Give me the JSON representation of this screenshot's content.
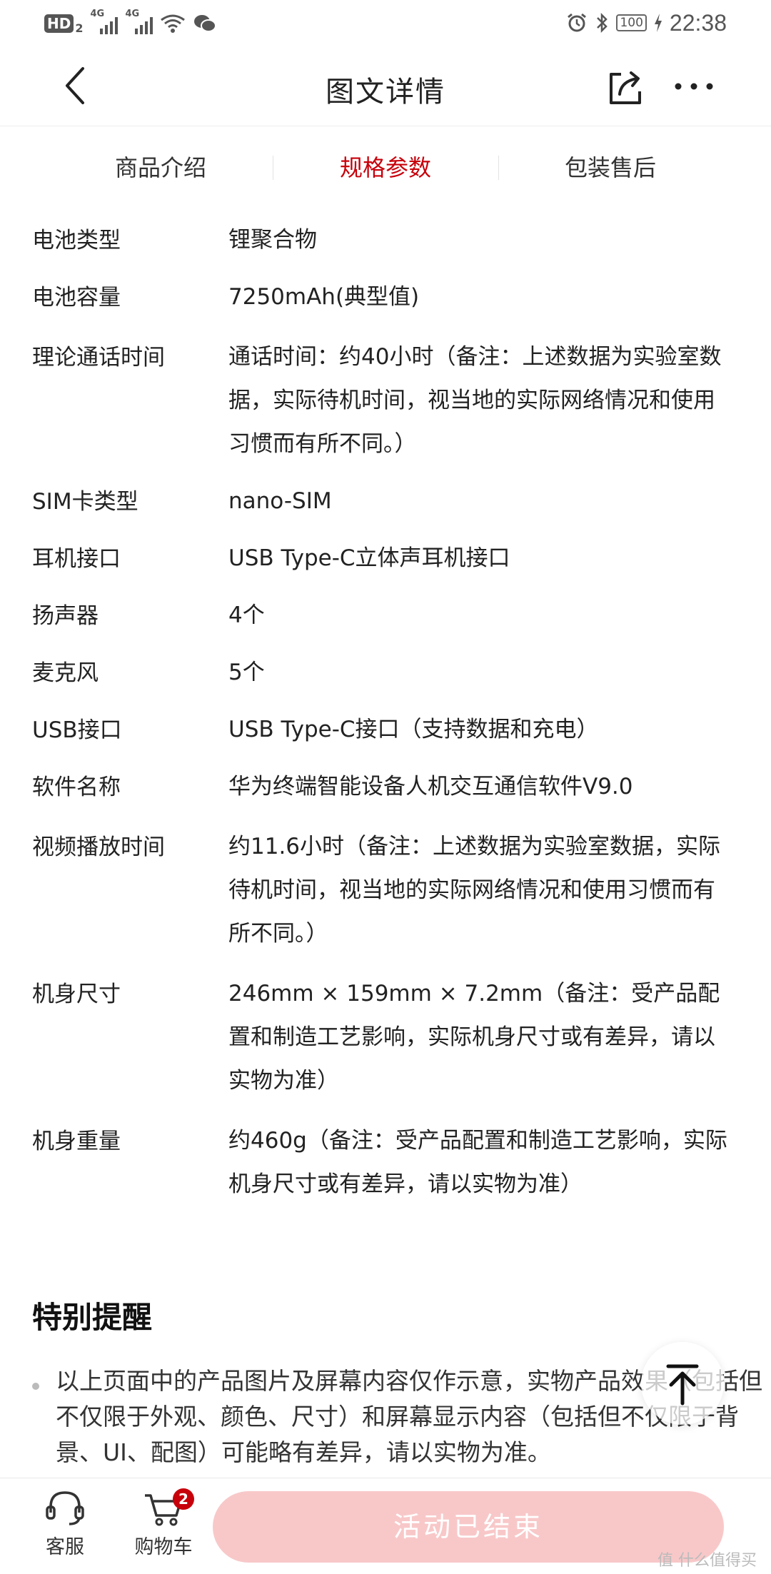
{
  "status_bar": {
    "hd_label": "HD",
    "hd_sub": "2",
    "sim1_tag": "4G",
    "sim2_tag": "4G",
    "battery": "100",
    "time": "22:38"
  },
  "nav": {
    "title": "图文详情"
  },
  "tabs": [
    {
      "label": "商品介绍",
      "active": false
    },
    {
      "label": "规格参数",
      "active": true
    },
    {
      "label": "包装售后",
      "active": false
    }
  ],
  "specs": [
    {
      "key": "电池类型",
      "value": "锂聚合物"
    },
    {
      "key": "电池容量",
      "value": "7250mAh(典型值)"
    },
    {
      "key": "理论通话时间",
      "value": "通话时间：约40小时（备注：上述数据为实验室数据，实际待机时间，视当地的实际网络情况和使用习惯而有所不同。）"
    },
    {
      "key": "SIM卡类型",
      "value": "nano-SIM"
    },
    {
      "key": "耳机接口",
      "value": "USB Type-C立体声耳机接口"
    },
    {
      "key": "扬声器",
      "value": "4个"
    },
    {
      "key": "麦克风",
      "value": "5个"
    },
    {
      "key": "USB接口",
      "value": "USB Type-C接口（支持数据和充电）"
    },
    {
      "key": "软件名称",
      "value": "华为终端智能设备人机交互通信软件V9.0"
    },
    {
      "key": "视频播放时间",
      "value": "约11.6小时（备注：上述数据为实验室数据，实际待机时间，视当地的实际网络情况和使用习惯而有所不同。）"
    },
    {
      "key": "机身尺寸",
      "value": "246mm × 159mm × 7.2mm（备注：受产品配置和制造工艺影响，实际机身尺寸或有差异，请以实物为准）"
    },
    {
      "key": "机身重量",
      "value": "约460g（备注：受产品配置和制造工艺影响，实际机身尺寸或有差异，请以实物为准）"
    }
  ],
  "reminder": {
    "title": "特别提醒",
    "items": [
      "以上页面中的产品图片及屏幕内容仅作示意，实物产品效果（包括但不仅限于外观、颜色、尺寸）和屏幕显示内容（包括但不仅限于背景、UI、配图）可能略有差异，请以实物为准。"
    ]
  },
  "bottom_bar": {
    "service_label": "客服",
    "cart_label": "购物车",
    "cart_count": "2",
    "buy_button": "活动已结束"
  },
  "watermark": "值 什么值得买",
  "colors": {
    "accent": "#c7000b",
    "disabled_button": "#f8c8c9"
  }
}
